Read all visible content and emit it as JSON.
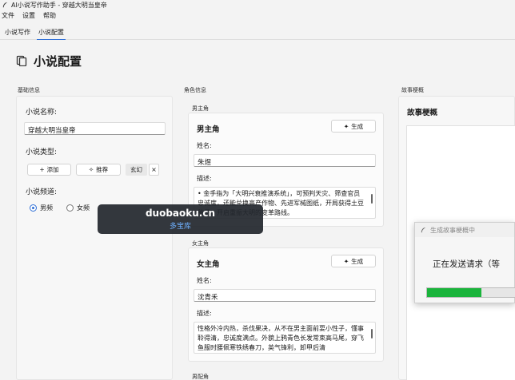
{
  "window": {
    "title": "AI小说写作助手 - 穿越大明当皇帝"
  },
  "menu": [
    "文件",
    "设置",
    "帮助"
  ],
  "tabs": [
    {
      "label": "小说写作",
      "active": false
    },
    {
      "label": "小说配置",
      "active": true
    }
  ],
  "page": {
    "title": "小说配置"
  },
  "sections": {
    "basic": "基础信息",
    "characters": "角色信息",
    "story": "故事梗概"
  },
  "basic": {
    "name_label": "小说名称:",
    "name_value": "穿越大明当皇帝",
    "type_label": "小说类型:",
    "add_label": "添加",
    "recommend_label": "推荐",
    "selected_type": "玄幻",
    "remove_symbol": "×",
    "channel_label": "小说频道:",
    "channels": [
      {
        "label": "男频",
        "checked": true
      },
      {
        "label": "女频",
        "checked": false
      }
    ]
  },
  "characters": {
    "male": {
      "section": "男主角",
      "role": "男主角",
      "generate_label": "生成",
      "name_label": "姓名:",
      "name_value": "朱煜",
      "desc_label": "描述:",
      "desc_value": "• 金手指为「大明兴衰推演系统」，可预判天灾、筛查官员忠诚度，还能兑换高产作物、先进军械图纸，开局获得土豆种子，开启重振大明的变革路线。"
    },
    "female": {
      "section": "女主角",
      "role": "女主角",
      "generate_label": "生成",
      "name_label": "姓名:",
      "name_value": "沈青禾",
      "desc_label": "描述:",
      "desc_value": "性格外冷内热，杀伐果决，从不在男主面前耍小性子，懂事聆得清，忠诚度满点。外貌上鸦青色长发常束高马尾，穿飞鱼服时腰佩寒铁绣春刀，英气锋利，卸甲后清"
    },
    "supporting": {
      "section": "男配角"
    }
  },
  "story": {
    "header": "故事梗概"
  },
  "dialog": {
    "title": "生成故事梗概中",
    "message": "正在发送请求（等",
    "progress": 0.62
  },
  "watermark": {
    "main": "duobaoku.cn",
    "sub": "多宝库"
  },
  "colors": {
    "accent": "#2f6fd6",
    "progress": "#1bb43c"
  }
}
